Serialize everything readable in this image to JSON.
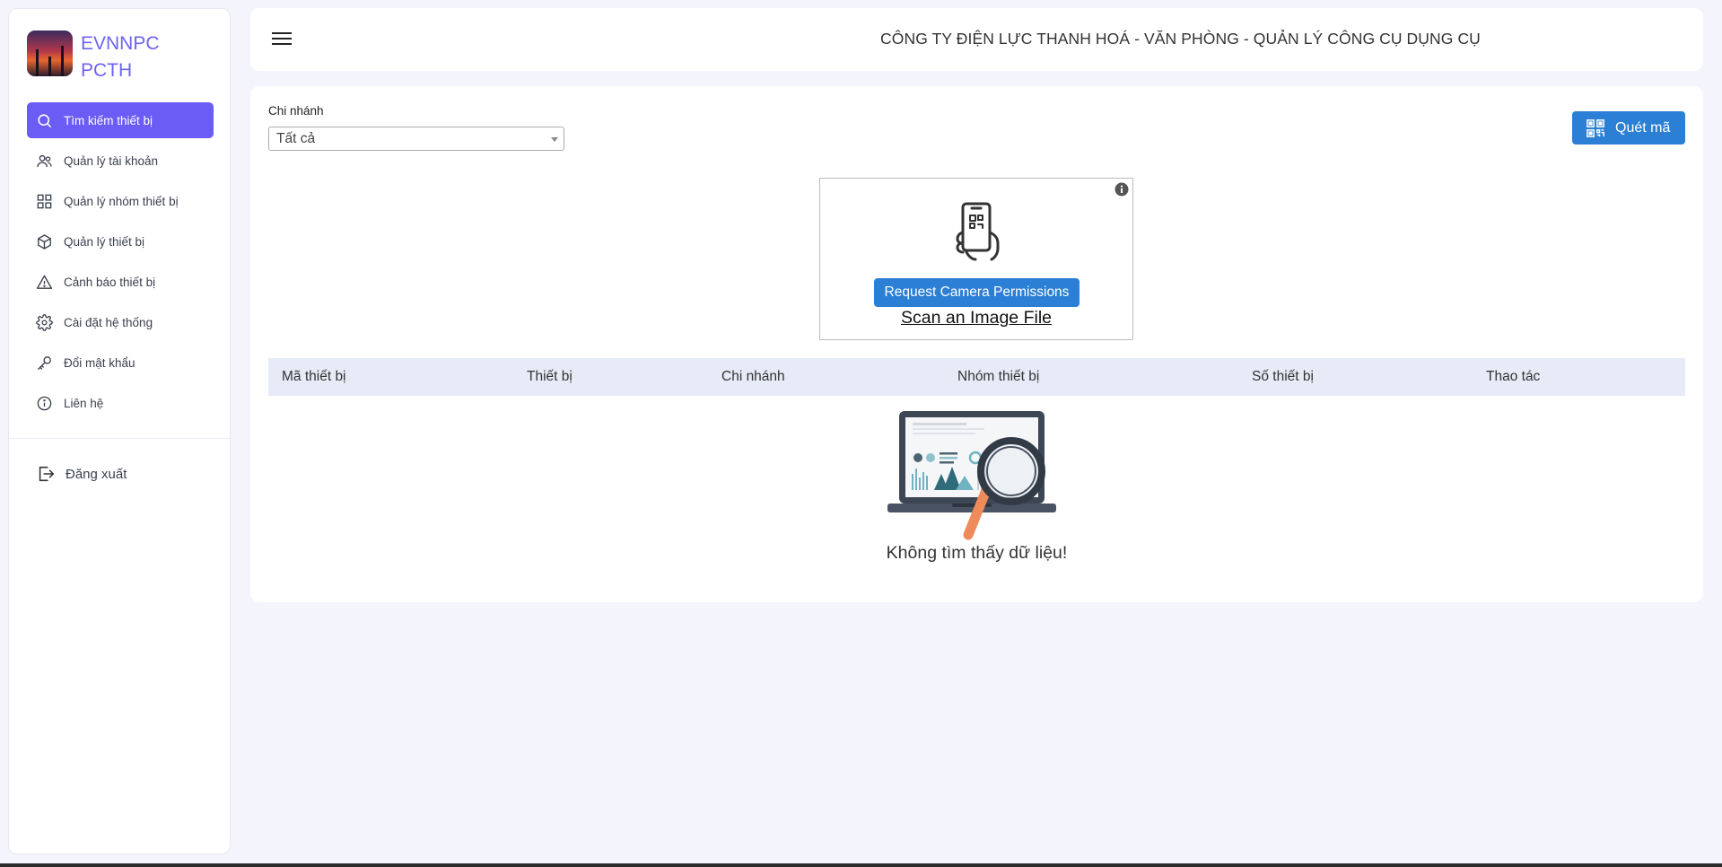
{
  "sidebar": {
    "brand_line1": "EVNNPC",
    "brand_line2": "PCTH",
    "items": [
      {
        "label": "Tìm kiếm thiết bị",
        "icon": "search-icon",
        "active": true
      },
      {
        "label": "Quản lý tài khoản",
        "icon": "users-icon",
        "active": false
      },
      {
        "label": "Quản lý nhóm thiết bị",
        "icon": "grid-icon",
        "active": false
      },
      {
        "label": "Quản lý thiết bị",
        "icon": "box-icon",
        "active": false
      },
      {
        "label": "Cảnh báo thiết bị",
        "icon": "warning-icon",
        "active": false
      },
      {
        "label": "Cài đặt hệ thống",
        "icon": "gear-icon",
        "active": false
      },
      {
        "label": "Đổi mật khẩu",
        "icon": "key-icon",
        "active": false
      },
      {
        "label": "Liên hệ",
        "icon": "info-icon",
        "active": false
      }
    ],
    "logout_label": "Đăng xuất"
  },
  "header": {
    "title": "CÔNG TY ĐIỆN LỰC THANH HOÁ - VĂN PHÒNG - QUẢN LÝ CÔNG CỤ DỤNG CỤ"
  },
  "filter": {
    "branch_label": "Chi nhánh",
    "branch_value": "Tất cả"
  },
  "scan_button_label": "Quét mã",
  "scanner": {
    "camera_button_label": "Request Camera Permissions",
    "scan_file_label": "Scan an Image File"
  },
  "table": {
    "columns": [
      "Mã thiết bị",
      "Thiết bị",
      "Chi nhánh",
      "Nhóm thiết bị",
      "Số thiết bị",
      "Thao tác"
    ]
  },
  "empty_message": "Không tìm thấy dữ liệu!",
  "colors": {
    "accent": "#6b5cf6",
    "primary_button": "#2b7fd4",
    "page_bg": "#f4f4fd",
    "table_header_bg": "#e6ebf7"
  }
}
